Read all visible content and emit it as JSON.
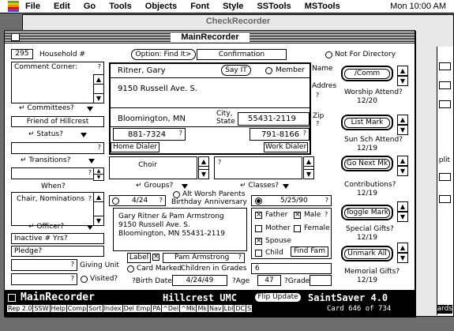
{
  "menubar": {
    "items": [
      "File",
      "Edit",
      "Go",
      "Tools",
      "Objects",
      "Font",
      "Style",
      "SSTools",
      "MSTools"
    ],
    "clock": "Mon 10:00 AM"
  },
  "back_window": {
    "title": "CheckRecorder",
    "right_label": "plit",
    "right_label2": "ards"
  },
  "window": {
    "title": "MainRecorder"
  },
  "record": {
    "household_no": "295",
    "household_label": "Household #",
    "option_button": "Option: Find It>",
    "confirmation": "Confirmation",
    "not_for_directory": "Not For Directory",
    "comment_label": "Comment Corner:",
    "committees_label": "Committees?",
    "committee_value": "Friend of Hillcrest",
    "status_label": "Status?",
    "transitions_label": "Transitions?",
    "when_label": "When?",
    "when_value": "Chair, Nominations",
    "officer_label": "Officer?",
    "inactive_label": "Inactive # Yrs?",
    "pledge_label": "Pledge?",
    "giving_unit": "Giving Unit",
    "visited": "Visited?",
    "name_value": "Ritner, Gary",
    "say_it": "Say IT",
    "member": "Member",
    "name_label": "Name",
    "address_label": "Address",
    "address_value": "9150 Russell Ave. S.",
    "city_value": "Bloomington, MN",
    "city_label": "City, State",
    "zip_label": "Zip",
    "zip_value": "55431-2119",
    "home_phone": "881-7324",
    "work_phone": "791-8166",
    "home_dialer": "Home Dialer",
    "work_dialer": "Work Dialer",
    "choir": "Choir",
    "groups_label": "Groups?",
    "classes_label": "Classes?",
    "alt_worsh": "Alt Worsh Parents",
    "birthday_label": "Birthday",
    "anniversary_label": "Anniversary",
    "birthday_value": "4/24",
    "anniversary_value": "5/25/90",
    "label_line1": "Gary Ritner & Pam Armstrong",
    "label_line2": "9150 Russell Ave. S.",
    "label_line3": "Bloomington, MN 55431-2119",
    "father": "Father",
    "male": "Male",
    "mother": "Mother",
    "female": "Female",
    "spouse": "Spouse",
    "child": "Child",
    "find_fam": "Find Fam",
    "label_button": "Label",
    "spouse_name": "Pam Armstrong",
    "card_marked": "Card Marked",
    "children_grades": "Children in Grades",
    "grades_value": "6",
    "birth_date_label": "?Birth Date",
    "birth_date": "4/24/49",
    "age_label": "?Age",
    "age": "47",
    "grade_label": "?Grade"
  },
  "right_panel": {
    "comm_button": "/Comm",
    "worship_label": "Worship Attend?",
    "worship_date": "12/20",
    "list_mark": "List Mark",
    "sun_sch": "Sun Sch Attend?",
    "sun_sch_date": "12/19",
    "go_next": "Go Next Mk",
    "contributions": "Contributions?",
    "contrib_date": "12/19",
    "toggle_mark": "Toggle Mark",
    "special_gifts": "Special Gifts?",
    "special_date": "12/19",
    "unmark_all": "Unmark All",
    "memorial": "Memorial Gifts?",
    "memorial_date": "12/19"
  },
  "footer": {
    "app_name": "MainRecorder",
    "church": "Hillcrest UMC",
    "flip_update": "Flip Update",
    "brand": "SaintSaver 4.0",
    "card_count": "Card 646 of 734",
    "shortcuts": [
      "Rep 2.0",
      "SSW",
      "Help",
      "Comp",
      "Sort",
      "Index",
      "Del Emp",
      "PA",
      "^Del",
      "^Mk",
      "Mk",
      "Nav",
      "Lbl",
      "DC",
      "S"
    ]
  }
}
